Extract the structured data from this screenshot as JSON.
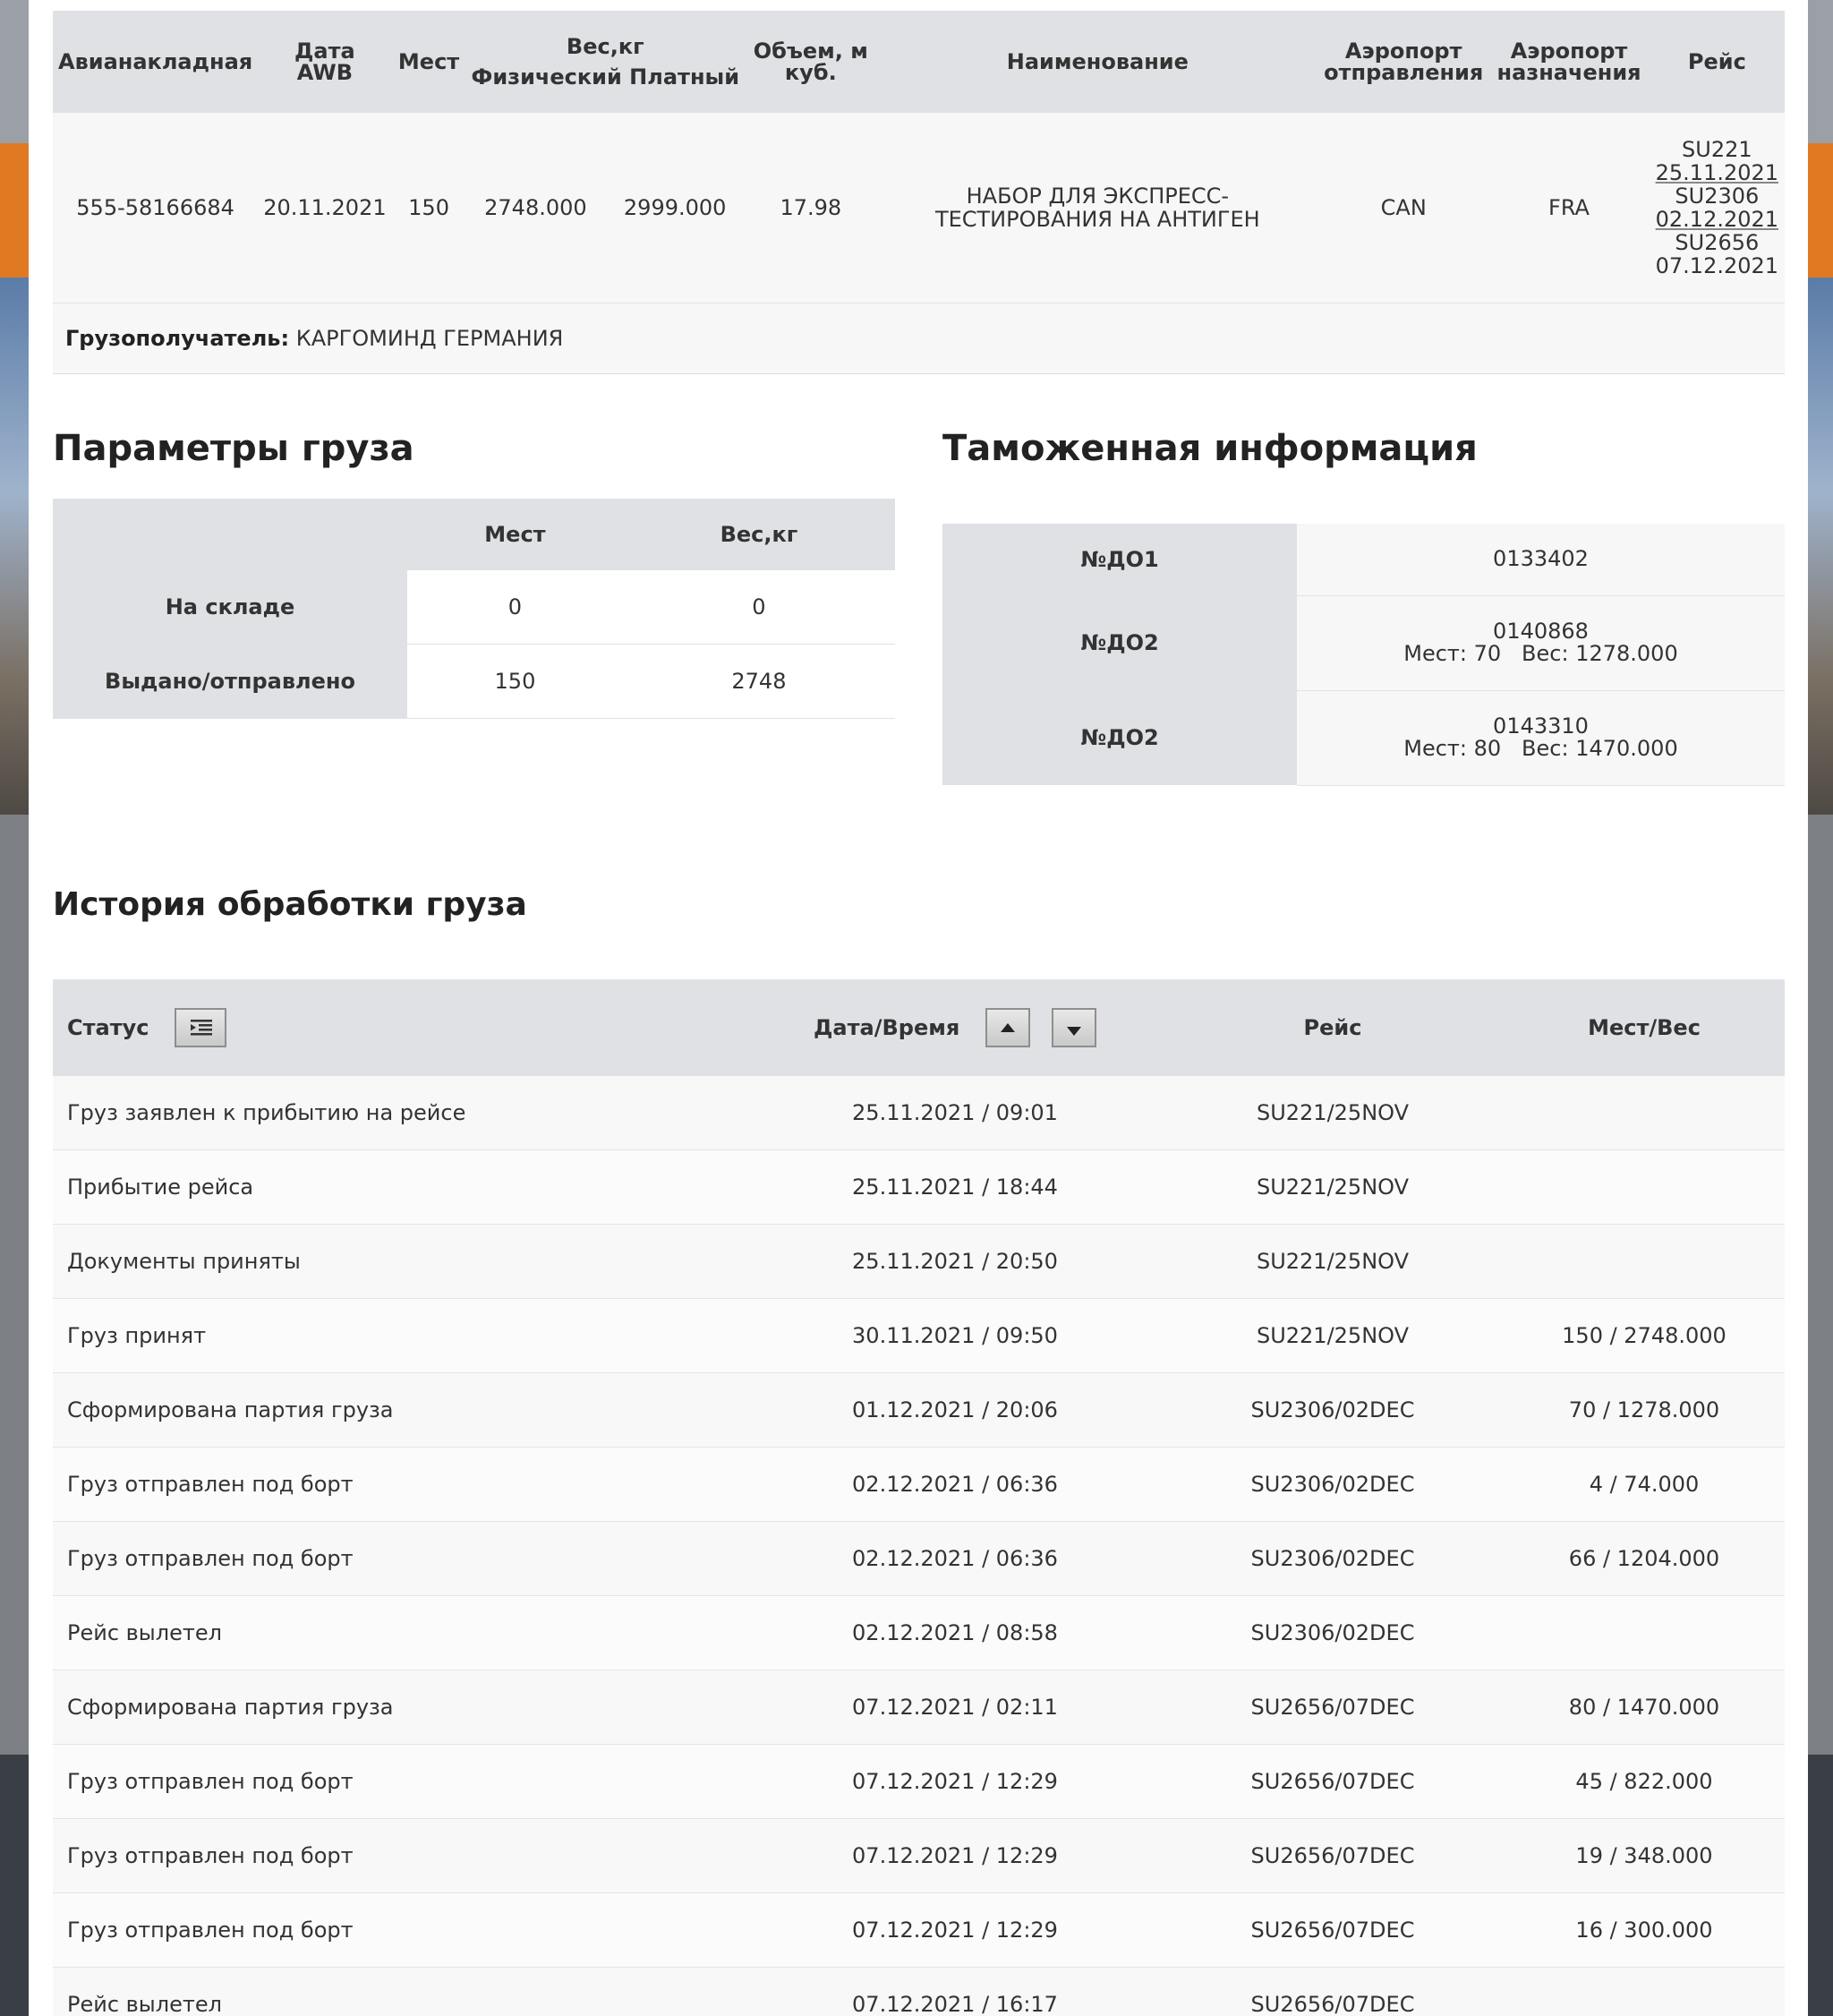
{
  "awb_table": {
    "headers": {
      "awb": "Авианакладная",
      "awb_date": "Дата AWB",
      "pieces": "Мест",
      "weight": "Вес,кг",
      "weight_physical": "Физический",
      "weight_paid": "Платный",
      "volume_line1": "Объем, м",
      "volume_line2": "куб.",
      "name": "Наименование",
      "dep_line1": "Аэропорт",
      "dep_line2": "отправления",
      "arr_line1": "Аэропорт",
      "arr_line2": "назначения",
      "flight": "Рейс"
    },
    "row": {
      "awb": "555-58166684",
      "awb_date": "20.11.2021",
      "pieces": "150",
      "weight_physical": "2748.000",
      "weight_paid": "2999.000",
      "volume": "17.98",
      "name": "НАБОР ДЛЯ ЭКСПРЕСС-ТЕСТИРОВАНИЯ НА АНТИГЕН",
      "dep": "CAN",
      "arr": "FRA",
      "flights": [
        {
          "flight": "SU221",
          "date": "25.11.2021"
        },
        {
          "flight": "SU2306",
          "date": "02.12.2021"
        },
        {
          "flight": "SU2656",
          "date": "07.12.2021"
        }
      ]
    },
    "consignee_label": "Грузополучатель:",
    "consignee_value": "КАРГОМИНД ГЕРМАНИЯ"
  },
  "params": {
    "title": "Параметры груза",
    "col_pieces": "Мест",
    "col_weight": "Вес,кг",
    "rows": [
      {
        "label": "На складе",
        "pieces": "0",
        "weight": "0"
      },
      {
        "label": "Выдано/отправлено",
        "pieces": "150",
        "weight": "2748"
      }
    ]
  },
  "customs": {
    "title": "Таможенная информация",
    "rows": [
      {
        "label": "№ДО1",
        "number": "0133402",
        "details": ""
      },
      {
        "label": "№ДО2",
        "number": "0140868",
        "details": "Мест: 70   Вес: 1278.000"
      },
      {
        "label": "№ДО2",
        "number": "0143310",
        "details": "Мест: 80   Вес: 1470.000"
      }
    ]
  },
  "history": {
    "title": "История обработки груза",
    "col_status": "Статус",
    "col_datetime": "Дата/Время",
    "col_flight": "Рейс",
    "col_pieces_weight": "Мест/Вес",
    "rows": [
      {
        "status": "Груз заявлен к прибытию на рейсе",
        "datetime": "25.11.2021 / 09:01",
        "flight": "SU221/25NOV",
        "pw": ""
      },
      {
        "status": "Прибытие рейса",
        "datetime": "25.11.2021 / 18:44",
        "flight": "SU221/25NOV",
        "pw": ""
      },
      {
        "status": "Документы приняты",
        "datetime": "25.11.2021 / 20:50",
        "flight": "SU221/25NOV",
        "pw": ""
      },
      {
        "status": "Груз принят",
        "datetime": "30.11.2021 / 09:50",
        "flight": "SU221/25NOV",
        "pw": "150 / 2748.000"
      },
      {
        "status": "Сформирована партия груза",
        "datetime": "01.12.2021 / 20:06",
        "flight": "SU2306/02DEC",
        "pw": "70 / 1278.000"
      },
      {
        "status": "Груз отправлен под борт",
        "datetime": "02.12.2021 / 06:36",
        "flight": "SU2306/02DEC",
        "pw": "4 / 74.000"
      },
      {
        "status": "Груз отправлен под борт",
        "datetime": "02.12.2021 / 06:36",
        "flight": "SU2306/02DEC",
        "pw": "66 / 1204.000"
      },
      {
        "status": "Рейс вылетел",
        "datetime": "02.12.2021 / 08:58",
        "flight": "SU2306/02DEC",
        "pw": ""
      },
      {
        "status": "Сформирована партия груза",
        "datetime": "07.12.2021 / 02:11",
        "flight": "SU2656/07DEC",
        "pw": "80 / 1470.000"
      },
      {
        "status": "Груз отправлен под борт",
        "datetime": "07.12.2021 / 12:29",
        "flight": "SU2656/07DEC",
        "pw": "45 / 822.000"
      },
      {
        "status": "Груз отправлен под борт",
        "datetime": "07.12.2021 / 12:29",
        "flight": "SU2656/07DEC",
        "pw": "19 / 348.000"
      },
      {
        "status": "Груз отправлен под борт",
        "datetime": "07.12.2021 / 12:29",
        "flight": "SU2656/07DEC",
        "pw": "16 / 300.000"
      },
      {
        "status": "Рейс вылетел",
        "datetime": "07.12.2021 / 16:17",
        "flight": "SU2656/07DEC",
        "pw": ""
      }
    ]
  }
}
